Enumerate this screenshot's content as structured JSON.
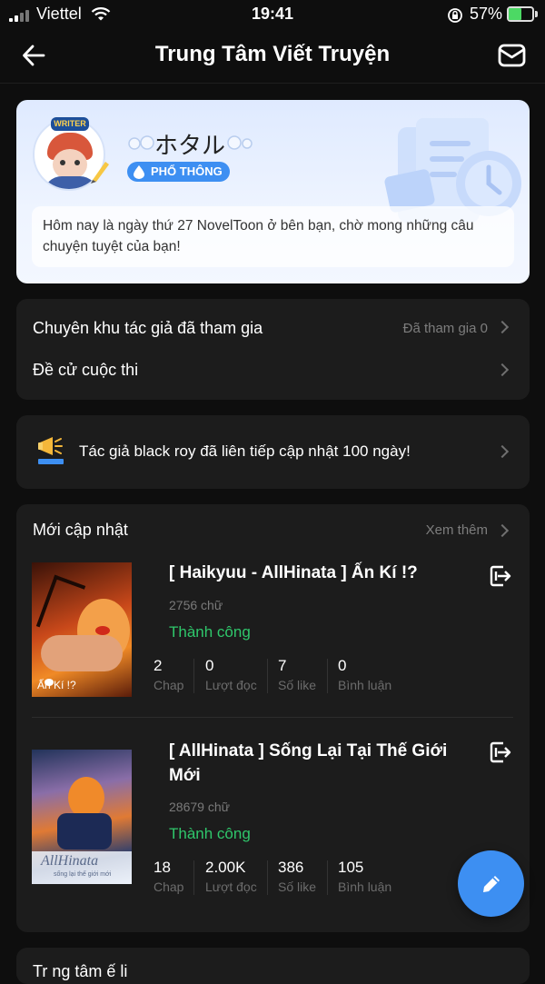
{
  "status_bar": {
    "carrier": "Viettel",
    "time": "19:41",
    "battery": "57%"
  },
  "header": {
    "title": "Trung Tâm Viết Truyện"
  },
  "profile": {
    "badge": "WRITER",
    "name": "ホタル",
    "tier": "PHỔ THÔNG",
    "message": "Hôm nay là ngày thứ 27 NovelToon ở bên bạn, chờ mong những câu chuyện tuyệt của bạn!"
  },
  "menu": {
    "zone_label": "Chuyên khu tác giả đã tham gia",
    "zone_status": "Đã tham gia 0",
    "contest_label": "Đề cử cuộc thi"
  },
  "announcement": {
    "text": "Tác giả black roy đã liên tiếp cập nhật 100 ngày!"
  },
  "recent": {
    "title": "Mới cập nhật",
    "more": "Xem thêm",
    "books": [
      {
        "title": "[ Haikyuu - AllHinata ] Ấn Kí !?",
        "words": "2756 chữ",
        "status": "Thành công",
        "cover_text": "Ấn Kí !?",
        "stats": [
          {
            "value": "2",
            "label": "Chap"
          },
          {
            "value": "0",
            "label": "Lượt đọc"
          },
          {
            "value": "7",
            "label": "Số like"
          },
          {
            "value": "0",
            "label": "Bình luận"
          }
        ]
      },
      {
        "title": "[ AllHinata ] Sống Lại Tại Thế Giới Mới",
        "words": "28679 chữ",
        "status": "Thành công",
        "cover_text": "AllHinata",
        "cover_sub": "sống lại thế giới mới",
        "stats": [
          {
            "value": "18",
            "label": "Chap"
          },
          {
            "value": "2.00K",
            "label": "Lượt đọc"
          },
          {
            "value": "386",
            "label": "Số like"
          },
          {
            "value": "105",
            "label": "Bình luận"
          }
        ]
      }
    ]
  },
  "bottom_section": {
    "title": "Tr ng tâm  ế li "
  },
  "colors": {
    "accent_blue": "#3d8ff2",
    "success_green": "#2fc76b",
    "card_bg": "#1c1c1c"
  }
}
